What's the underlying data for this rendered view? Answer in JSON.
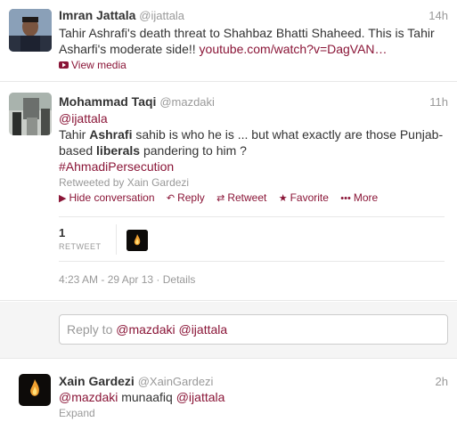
{
  "tweet1": {
    "name": "Imran Jattala",
    "handle": "@ijattala",
    "time": "14h",
    "line1": "Tahir Ashrafi's death threat to Shahbaz Bhatti Shaheed. This is Tahir",
    "line2_prefix": "Asharfi's moderate side!! ",
    "line2_link": "youtube.com/watch?v=DagVAN…",
    "view_media": "View media"
  },
  "tweet2": {
    "name": "Mohammad Taqi",
    "handle": "@mazdaki",
    "time": "11h",
    "mention": "@ijattala",
    "l1a": "Tahir ",
    "l1b": "Ashrafi",
    "l1c": " sahib is who he is ... but what exactly are those Punjab-",
    "l2a": "based ",
    "l2b": "liberals",
    "l2c": " pandering to him ?",
    "hashtag": "#AhmadiPersecution",
    "retweeted_by": "Retweeted by Xain Gardezi",
    "actions": {
      "hide": "Hide conversation",
      "reply": "Reply",
      "retweet": "Retweet",
      "favorite": "Favorite",
      "more": "More"
    },
    "retweet_count": "1",
    "retweet_label": "RETWEET",
    "timestamp": "4:23 AM - 29 Apr 13",
    "details": "Details"
  },
  "reply": {
    "prefix": "Reply to ",
    "mention1": "@mazdaki",
    "mention2": "@ijattala"
  },
  "tweet3": {
    "name": "Xain Gardezi",
    "handle": "@XainGardezi",
    "time": "2h",
    "mention1": "@mazdaki",
    "word": " munaafiq ",
    "mention2": "@ijattala",
    "expand": "Expand"
  },
  "colors": {
    "link": "#8a1537",
    "text": "#333333",
    "muted": "#999999"
  }
}
